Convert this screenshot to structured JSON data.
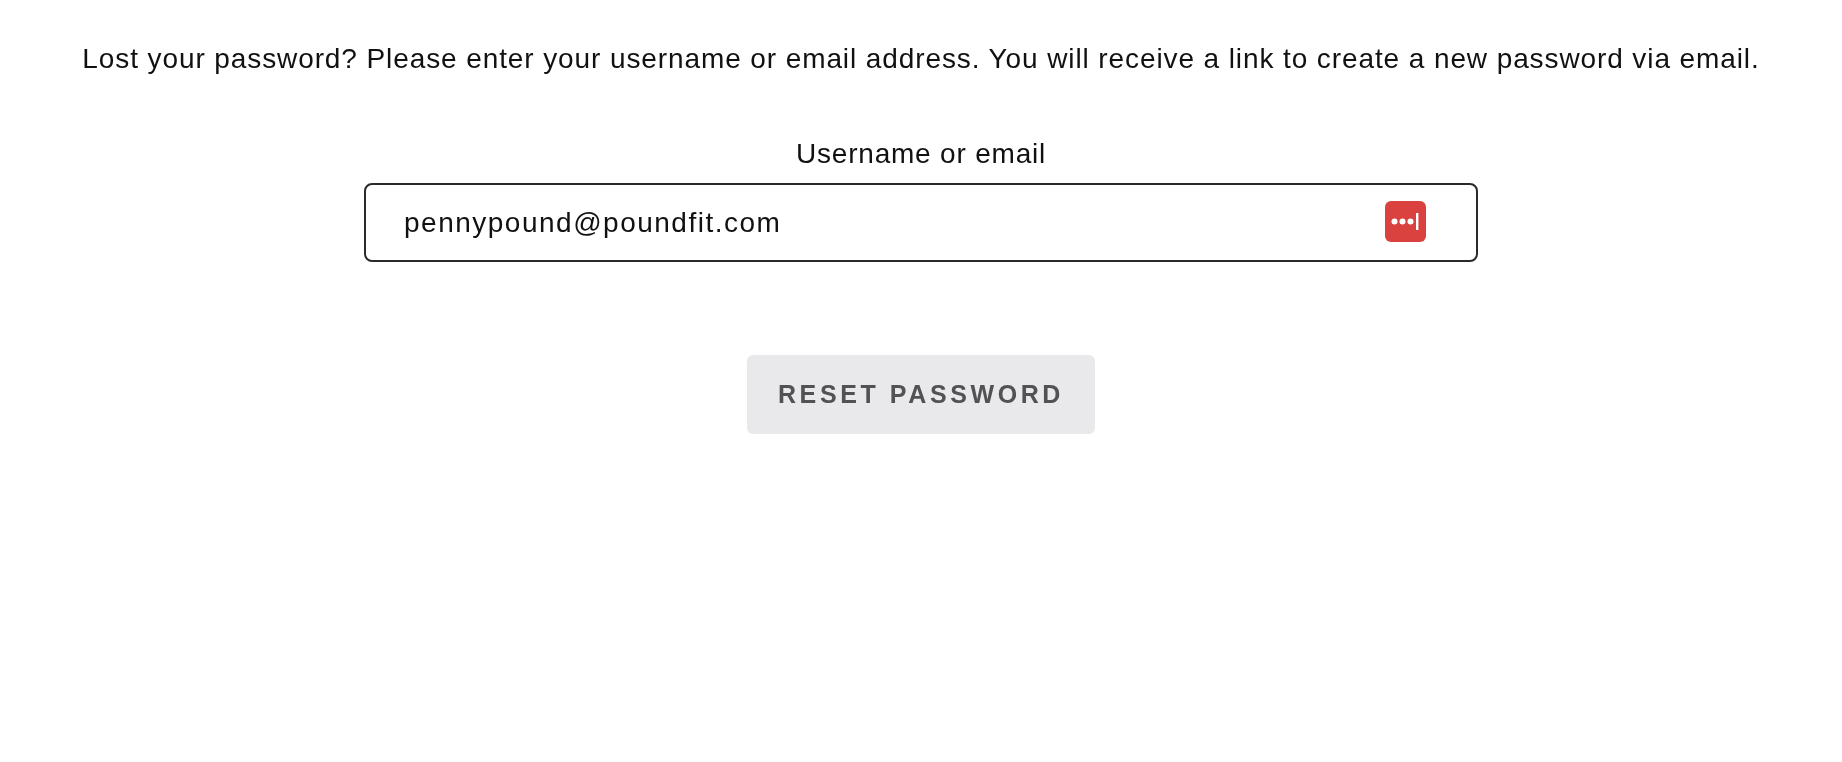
{
  "intro": "Lost your password? Please enter your username or email address. You will receive a link to create a new password via email.",
  "form": {
    "label": "Username or email",
    "field": {
      "value": "pennypound@poundfit.com"
    },
    "submit": "RESET PASSWORD"
  }
}
